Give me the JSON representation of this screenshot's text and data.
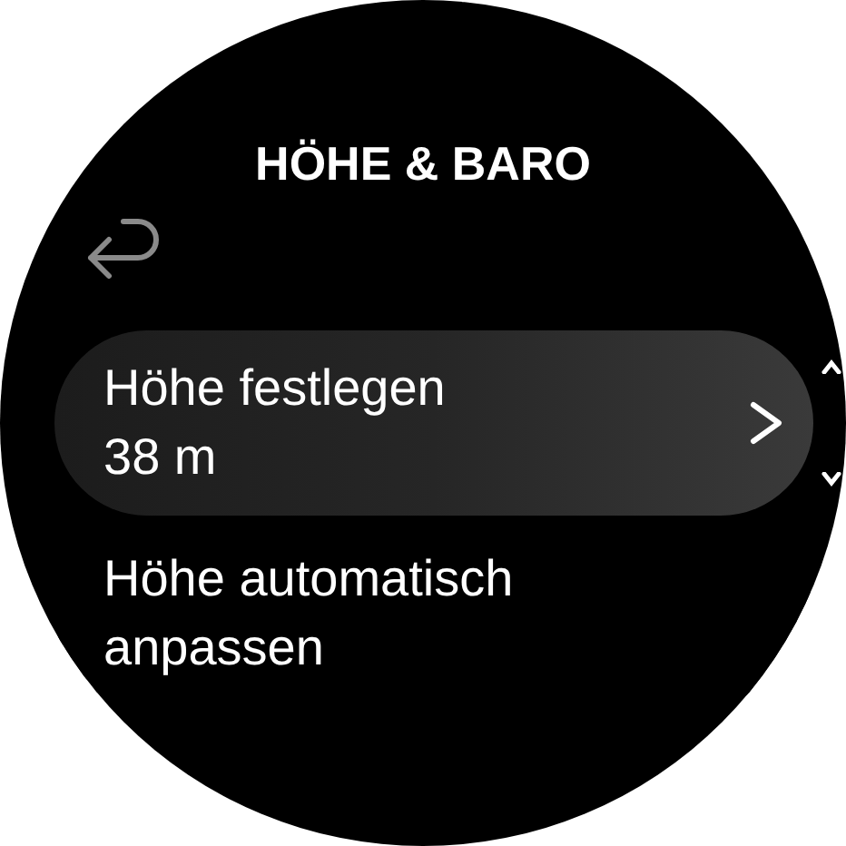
{
  "title": "HÖHE & BARO",
  "items": [
    {
      "label": "Höhe festlegen",
      "value": "38 m",
      "selected": true,
      "kind": "submenu"
    },
    {
      "label": "Höhe automatisch anpassen",
      "selected": false,
      "kind": "plain"
    }
  ]
}
